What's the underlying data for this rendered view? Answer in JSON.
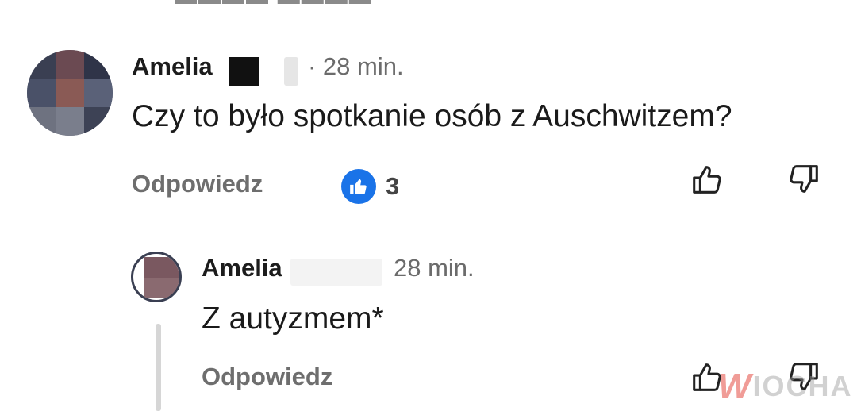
{
  "comments": [
    {
      "author": "Amelia",
      "meta": "· 28 min.",
      "text": "Czy to było spotkanie osób z Auschwitzem?",
      "reply_label": "Odpowiedz",
      "reaction_count": "3",
      "avatar_colors": [
        "#3a3f52",
        "#6b4a52",
        "#2f3448",
        "#4a5168",
        "#8a5a55",
        "#5a6178",
        "#6e7280",
        "#7a7e8c",
        "#3d4255"
      ]
    },
    {
      "author": "Amelia",
      "meta": "28 min.",
      "text": "Z autyzmem*",
      "reply_label": "Odpowiedz",
      "avatar_colors": [
        "#7a5860",
        "#8a6a70"
      ]
    }
  ],
  "watermark": {
    "logo_letter": "W",
    "text": "IOCHA"
  },
  "icons": {
    "like": "thumb-up-icon",
    "dislike": "thumb-down-icon",
    "reaction": "like-reaction-icon"
  },
  "colors": {
    "reaction_blue": "#1a73e8",
    "watermark_red": "#e0261b"
  }
}
